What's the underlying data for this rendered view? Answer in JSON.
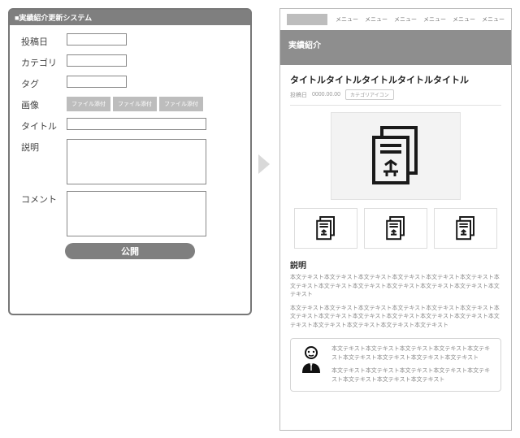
{
  "left": {
    "title": "■実績紹介更新システム",
    "labels": {
      "date": "投稿日",
      "category": "カテゴリ",
      "tag": "タグ",
      "image": "画像",
      "title": "タイトル",
      "desc": "説明",
      "comment": "コメント"
    },
    "file_btn": "ファイル添付",
    "publish": "公開"
  },
  "right": {
    "nav_item": "メニュー",
    "hero": "実績紹介",
    "title": "タイトルタイトルタイトルタイトルタイトル",
    "meta": {
      "date_label": "投稿日",
      "date_value": "0000.00.00",
      "badge": "カテゴリアイコン"
    },
    "desc_heading": "説明",
    "p1": "本文テキスト本文テキスト本文テキスト本文テキスト本文テキスト本文テキスト本文テキスト本文テキスト本文テキスト本文テキスト本文テキスト本文テキスト本文テキスト",
    "p2": "本文テキスト本文テキスト本文テキスト本文テキスト本文テキスト本文テキスト本文テキスト本文テキスト本文テキスト本文テキスト本文テキスト本文テキスト本文テキスト本文テキスト本文テキスト本文テキスト本文テキスト",
    "c1": "本文テキスト本文テキスト本文テキスト本文テキスト本文テキスト本文テキスト本文テキスト本文テキスト本文テキスト",
    "c2": "本文テキスト本文テキスト本文テキスト本文テキスト本文テキスト本文テキスト本文テキスト本文テキスト"
  }
}
